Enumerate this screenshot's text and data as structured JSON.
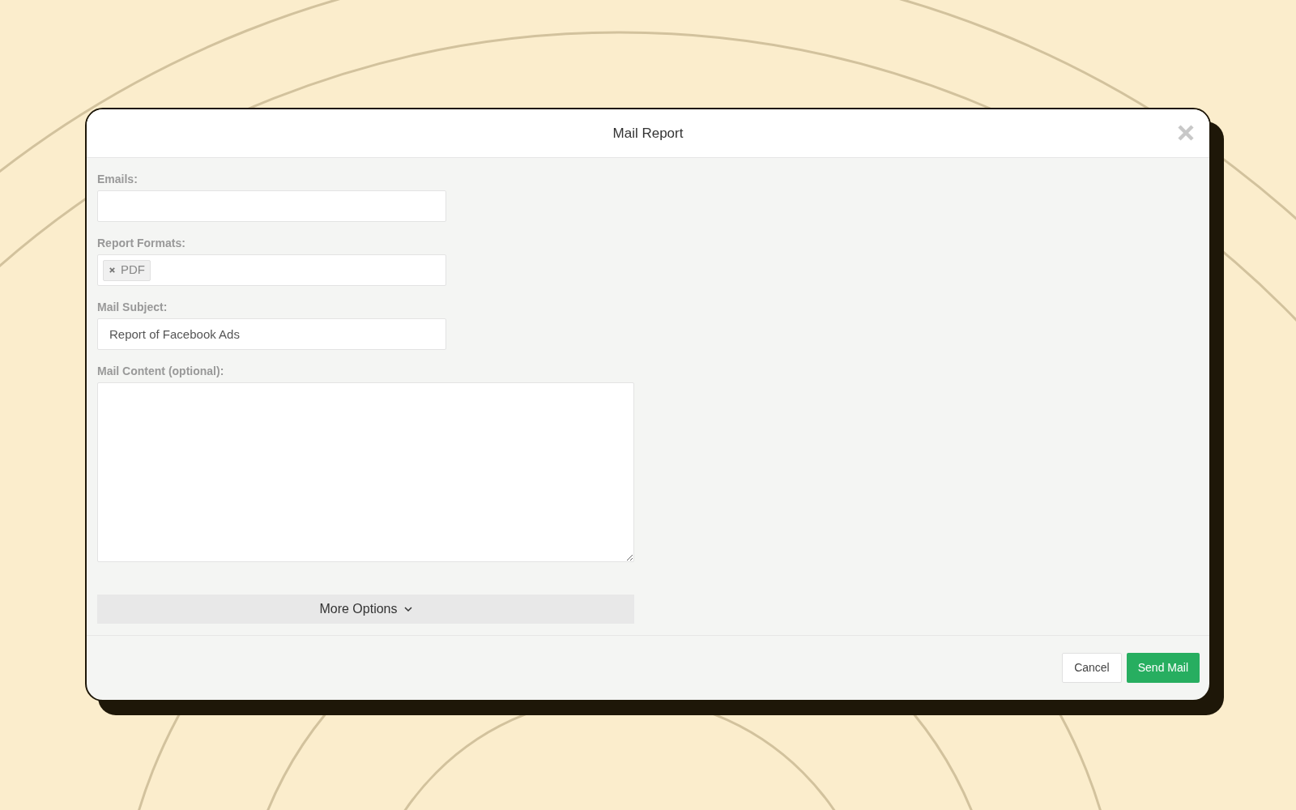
{
  "dialog": {
    "title": "Mail Report"
  },
  "fields": [
    {
      "kind": "input",
      "label": "Emails:"
    },
    {
      "kind": "tags",
      "label": "Report Formats:",
      "tags": [
        "PDF"
      ]
    },
    {
      "kind": "input",
      "label": "Mail Subject:",
      "value": "Report of Facebook Ads"
    },
    {
      "kind": "textarea",
      "label": "Mail Content (optional):"
    }
  ],
  "more_options": {
    "label": "More Options",
    "expanded": false
  },
  "buttons": [
    {
      "label": "Cancel",
      "kind": "secondary"
    },
    {
      "label": "Send Mail",
      "kind": "primary"
    }
  ]
}
